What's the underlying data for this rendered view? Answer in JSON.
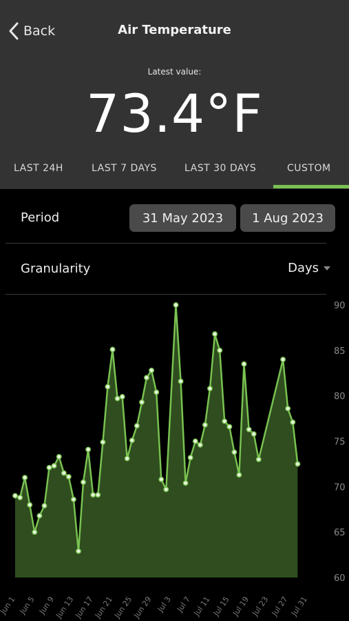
{
  "nav": {
    "back_label": "Back",
    "title": "Air Temperature"
  },
  "latest": {
    "label": "Latest value:",
    "value": "73.4°F"
  },
  "tabs": [
    "LAST 24H",
    "LAST 7 DAYS",
    "LAST 30 DAYS",
    "CUSTOM"
  ],
  "active_tab": "CUSTOM",
  "period": {
    "label": "Period",
    "start": "31 May 2023",
    "end": "1 Aug 2023"
  },
  "granularity": {
    "label": "Granularity",
    "value": "Days"
  },
  "colors": {
    "accent": "#79c251",
    "header_bg": "#333333",
    "fill": "#2f4d1f"
  },
  "chart_data": {
    "type": "area",
    "x_ticks": [
      "Jun 1",
      "Jun 5",
      "Jun 9",
      "Jun 13",
      "Jun 17",
      "Jun 21",
      "Jun 25",
      "Jun 29",
      "Jul 3",
      "Jul 7",
      "Jul 11",
      "Jul 15",
      "Jul 19",
      "Jul 23",
      "Jul 27",
      "Jul 31"
    ],
    "y_ticks": [
      60,
      65,
      70,
      75,
      80,
      85,
      90
    ],
    "ylim": [
      60,
      90
    ],
    "x_range_days": "May 31 – Aug 1, 2023",
    "series": [
      {
        "points": [
          [
            "2023-05-31",
            69.0
          ],
          [
            "2023-06-01",
            68.8
          ],
          [
            "2023-06-02",
            71.0
          ],
          [
            "2023-06-03",
            68.0
          ],
          [
            "2023-06-04",
            65.0
          ],
          [
            "2023-06-05",
            66.8
          ],
          [
            "2023-06-06",
            67.9
          ],
          [
            "2023-06-07",
            72.1
          ],
          [
            "2023-06-08",
            72.3
          ],
          [
            "2023-06-09",
            73.3
          ],
          [
            "2023-06-10",
            71.5
          ],
          [
            "2023-06-11",
            71.1
          ],
          [
            "2023-06-12",
            68.6
          ],
          [
            "2023-06-13",
            62.9
          ],
          [
            "2023-06-14",
            70.5
          ],
          [
            "2023-06-15",
            74.1
          ],
          [
            "2023-06-16",
            69.1
          ],
          [
            "2023-06-17",
            69.1
          ],
          [
            "2023-06-18",
            74.9
          ],
          [
            "2023-06-19",
            81.0
          ],
          [
            "2023-06-20",
            85.1
          ],
          [
            "2023-06-21",
            79.7
          ],
          [
            "2023-06-22",
            79.9
          ],
          [
            "2023-06-23",
            73.1
          ],
          [
            "2023-06-24",
            75.1
          ],
          [
            "2023-06-25",
            76.7
          ],
          [
            "2023-06-26",
            79.3
          ],
          [
            "2023-06-27",
            82.0
          ],
          [
            "2023-06-28",
            82.8
          ],
          [
            "2023-06-29",
            80.4
          ],
          [
            "2023-06-30",
            70.8
          ],
          [
            "2023-07-01",
            69.7
          ],
          [
            "2023-07-03",
            90.0
          ],
          [
            "2023-07-04",
            81.6
          ],
          [
            "2023-07-05",
            70.4
          ],
          [
            "2023-07-06",
            73.2
          ],
          [
            "2023-07-07",
            75.0
          ],
          [
            "2023-07-08",
            74.6
          ],
          [
            "2023-07-09",
            76.8
          ],
          [
            "2023-07-10",
            80.8
          ],
          [
            "2023-07-11",
            86.8
          ],
          [
            "2023-07-12",
            85.0
          ],
          [
            "2023-07-13",
            77.2
          ],
          [
            "2023-07-14",
            76.6
          ],
          [
            "2023-07-15",
            73.8
          ],
          [
            "2023-07-16",
            71.3
          ],
          [
            "2023-07-17",
            83.5
          ],
          [
            "2023-07-18",
            76.3
          ],
          [
            "2023-07-19",
            75.8
          ],
          [
            "2023-07-20",
            73.0
          ],
          [
            "2023-07-25",
            84.0
          ],
          [
            "2023-07-26",
            78.6
          ],
          [
            "2023-07-27",
            77.1
          ],
          [
            "2023-07-28",
            72.5
          ]
        ]
      }
    ],
    "grid": false
  }
}
